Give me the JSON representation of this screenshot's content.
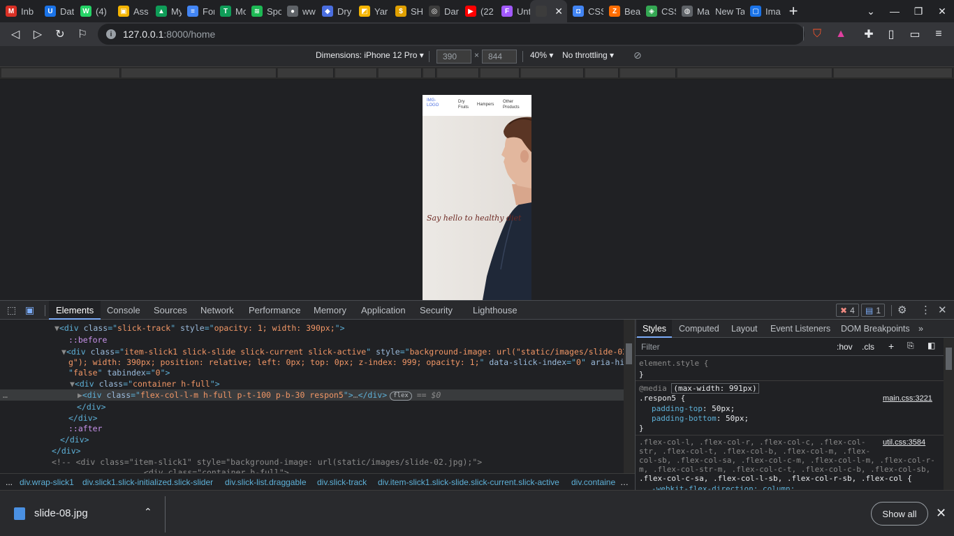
{
  "tabs": [
    {
      "label": "Inb",
      "color": "#d93025",
      "glyph": "M"
    },
    {
      "label": "Dat",
      "color": "#1a73e8",
      "glyph": "U"
    },
    {
      "label": "(4)",
      "color": "#25d366",
      "glyph": "W"
    },
    {
      "label": "Ass",
      "color": "#f4b400",
      "glyph": "▣"
    },
    {
      "label": "My",
      "color": "#0f9d58",
      "glyph": "▲"
    },
    {
      "label": "For",
      "color": "#4285f4",
      "glyph": "≡"
    },
    {
      "label": "Mo",
      "color": "#0f9d58",
      "glyph": "T"
    },
    {
      "label": "Spo",
      "color": "#1db954",
      "glyph": "≋"
    },
    {
      "label": "ww",
      "color": "#5f6368",
      "glyph": "●"
    },
    {
      "label": "Dry",
      "color": "#4a6ee0",
      "glyph": "◆"
    },
    {
      "label": "Yar",
      "color": "#f4b400",
      "glyph": "◩"
    },
    {
      "label": "SH",
      "color": "#e0a000",
      "glyph": "$"
    },
    {
      "label": "Dar",
      "color": "#3c3c3c",
      "glyph": "◎"
    },
    {
      "label": "(22",
      "color": "#ff0000",
      "glyph": "▶"
    },
    {
      "label": "Unt",
      "color": "#a259ff",
      "glyph": "F"
    },
    {
      "label": "",
      "color": "#3c3c3c",
      "glyph": ""
    },
    {
      "label": "CSS",
      "color": "#4285f4",
      "glyph": "◘"
    },
    {
      "label": "Bea",
      "color": "#ff6d00",
      "glyph": "Z"
    },
    {
      "label": "CSS",
      "color": "#34a853",
      "glyph": "◈"
    },
    {
      "label": "Ma",
      "color": "#5f6368",
      "glyph": "◍"
    },
    {
      "label": "New Ta",
      "color": "",
      "glyph": ""
    },
    {
      "label": "Ima",
      "color": "#1a73e8",
      "glyph": "▢"
    }
  ],
  "url": {
    "host": "127.0.0.1",
    "path": ":8000/home"
  },
  "device_toolbar": {
    "dimensions_label": "Dimensions: iPhone 12 Pro",
    "width": "390",
    "times": "×",
    "height": "844",
    "zoom": "40%",
    "throttling": "No throttling"
  },
  "device_page": {
    "logo": "IMG-LOGO",
    "nav": [
      "Dry Fruits",
      "Hampers",
      "Other Products"
    ],
    "slogan": "Say hello to healthy diet"
  },
  "devtools": {
    "tabs": [
      "Elements",
      "Console",
      "Sources",
      "Network",
      "Performance",
      "Memory",
      "Application",
      "Security",
      "Lighthouse"
    ],
    "errors": "4",
    "messages": "1"
  },
  "breadcrumbs": [
    "...",
    "div.wrap-slick1",
    "div.slick1.slick-initialized.slick-slider",
    "div.slick-list.draggable",
    "div.slick-track",
    "div.item-slick1.slick-slide.slick-current.slick-active",
    "div.containe"
  ],
  "styles_panel": {
    "tabs": [
      "Styles",
      "Computed",
      "Layout",
      "Event Listeners",
      "DOM Breakpoints",
      "»"
    ],
    "filter_placeholder": "Filter",
    "hov": ":hov",
    "cls": ".cls",
    "element_style": "element.style {",
    "close_brace": "}",
    "media_kw": "@media",
    "media_query": "(max-width: 991px)",
    "rule_selector": ".respon5 {",
    "rule_source": "main.css:3221",
    "prop1": "padding-top",
    "val1": "50px;",
    "prop2": "padding-bottom",
    "val2": "50px;",
    "util_source": "util.css:3584",
    "util_sel_1": ".flex-col-l, .flex-col-r, .flex-col-c, .flex-col-",
    "util_sel_2": "str, .flex-col-t, .flex-col-b, .flex-col-m, .flex-",
    "util_sel_3": "col-sb, .flex-col-sa, .flex-col-c-m, .flex-col-l-m, .flex-col-r-",
    "util_sel_4": "m, .flex-col-str-m, .flex-col-c-t, .flex-col-c-b, .flex-col-sb,",
    "util_sel_5": ".flex-col-c-sa, .flex-col-l-sb, .flex-col-r-sb, .flex-col {",
    "util_partial": "-webkit-flex-direction: column;"
  },
  "download": {
    "filename": "slide-08.jpg",
    "show_all": "Show all"
  }
}
